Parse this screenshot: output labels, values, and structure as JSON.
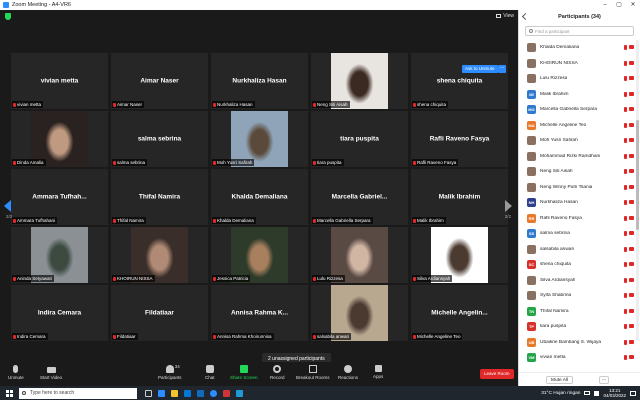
{
  "window": {
    "title": "Zoom Meeting - A4-VR6"
  },
  "view": {
    "label": "View"
  },
  "ask_to_unmute": "Ask to Unmute",
  "more_dots": "···",
  "page": {
    "left": "2/2",
    "right": "2/2"
  },
  "tiles": [
    {
      "center": "vivian metta",
      "label": "vivian metta"
    },
    {
      "center": "Aimar Naser",
      "label": "Aimar Naser"
    },
    {
      "center": "Nurkhaliza Hasan",
      "label": "Nurkhaliza Hasan"
    },
    {
      "center": "",
      "label": "Neng Siti Aisah",
      "photo": [
        "#e8e4e0",
        "#3a2a22"
      ]
    },
    {
      "center": "shena chiquita",
      "label": "shena chiquita"
    },
    {
      "center": "",
      "label": "Dinda Amalia",
      "photo": [
        "#2a2220",
        "#c09a80"
      ]
    },
    {
      "center": "salma sebrina",
      "label": "salma sebrina"
    },
    {
      "center": "",
      "label": "Moh Yusri Safirah",
      "photo": [
        "#8fa4b8",
        "#5a4a3a"
      ]
    },
    {
      "center": "tiara puspita",
      "label": "tiara puspita"
    },
    {
      "center": "Rafli Raveno Fasya",
      "label": "Rafli Raveno Fasya"
    },
    {
      "center": "Ammara  Tufhah...",
      "label": "Ammara Tufhahani"
    },
    {
      "center": "Thifal Namira",
      "label": "Thifal Namira"
    },
    {
      "center": "Khalda Demaliana",
      "label": "Khalda Demaliana"
    },
    {
      "center": "Marcella  Gabriel...",
      "label": "Marcella Gabriella Serpara"
    },
    {
      "center": "Malik Ibrahim",
      "label": "Malik Ibrahim"
    },
    {
      "center": "",
      "label": "Aninda Setyawati",
      "photo": [
        "#8a9094",
        "#3c4a40"
      ]
    },
    {
      "center": "",
      "label": "KHOIRUN NISSA",
      "photo": [
        "#3a2e2a",
        "#b08a74"
      ]
    },
    {
      "center": "",
      "label": "Jessica Patricia",
      "photo": [
        "#2e3a2a",
        "#a8805e"
      ]
    },
    {
      "center": "",
      "label": "Lulu Rizzesa",
      "photo": [
        "#5a4a44",
        "#d2b6a4"
      ]
    },
    {
      "center": "",
      "label": "Silva Ardiansyah",
      "photo": [
        "#ffffff",
        "#4a3a30"
      ]
    },
    {
      "center": "Indira Cemara",
      "label": "Indira Cemara"
    },
    {
      "center": "Fildatiaar",
      "label": "Fildatiaar"
    },
    {
      "center": "Annisa  Rahma  K...",
      "label": "Annisa Rahma Khoirunnisa"
    },
    {
      "center": "",
      "label": "salsabila anwari",
      "photo": [
        "#b8a890",
        "#4a3a30"
      ]
    },
    {
      "center": "Michelle  Angelin...",
      "label": "Michelle Angeline Teo"
    }
  ],
  "unassigned": "2 unassigned participants",
  "toolbar": {
    "unmute": "Unmute",
    "start_video": "Start Video",
    "participants": "Participants",
    "participants_count": "34",
    "chat": "Chat",
    "share_screen": "Share Screen",
    "record": "Record",
    "breakout_rooms": "Breakout Rooms",
    "reactions": "Reactions",
    "apps": "Apps",
    "leave": "Leave Room"
  },
  "panel": {
    "title": "Participants (34)",
    "search_placeholder": "Find a participant",
    "participants": [
      {
        "name": "Khalda Demaliana",
        "initials": "",
        "color": ""
      },
      {
        "name": "KHOIRUN NISSA",
        "initials": "",
        "color": ""
      },
      {
        "name": "Lulu Rizzesa",
        "initials": "",
        "color": ""
      },
      {
        "name": "Malik Ibrahim",
        "initials": "MI",
        "color": "#2f7ad0"
      },
      {
        "name": "Marcella Gabriella Serpara",
        "initials": "MG",
        "color": "#2f7ad0"
      },
      {
        "name": "Michelle Angeline Teo",
        "initials": "MA",
        "color": "#e8782a"
      },
      {
        "name": "Moh Yusri Safirah",
        "initials": "",
        "color": ""
      },
      {
        "name": "Mohammad Rizki Ramdhani",
        "initials": "",
        "color": ""
      },
      {
        "name": "Neng Siti Aisah",
        "initials": "",
        "color": ""
      },
      {
        "name": "Neng Winny Putri Tsania",
        "initials": "",
        "color": ""
      },
      {
        "name": "Nurkhaliza Hasan",
        "initials": "NH",
        "color": "#2e3f8c"
      },
      {
        "name": "Rafli Raveno Fasya",
        "initials": "RR",
        "color": "#e8782a"
      },
      {
        "name": "salma sebrina",
        "initials": "SS",
        "color": "#2f7ad0"
      },
      {
        "name": "salsabila anwari",
        "initials": "",
        "color": ""
      },
      {
        "name": "shena chiquita",
        "initials": "SC",
        "color": "#d7302a"
      },
      {
        "name": "Silva Ardiansyah",
        "initials": "",
        "color": ""
      },
      {
        "name": "Syifa Shabrina",
        "initials": "",
        "color": ""
      },
      {
        "name": "Thifal Namira",
        "initials": "TN",
        "color": "#23a548"
      },
      {
        "name": "tiara puspita",
        "initials": "TP",
        "color": "#d7302a"
      },
      {
        "name": "Ubaikrie Bambang S. Wijaya",
        "initials": "UB",
        "color": "#e8782a"
      },
      {
        "name": "vivian metta",
        "initials": "VM",
        "color": "#23a548"
      }
    ],
    "mute_all": "Mute All",
    "more": "..."
  },
  "taskbar": {
    "search_text": "Type here to search",
    "weather": "31°C  Hujan ringan",
    "time": "13:21",
    "date": "04/03/2022"
  }
}
